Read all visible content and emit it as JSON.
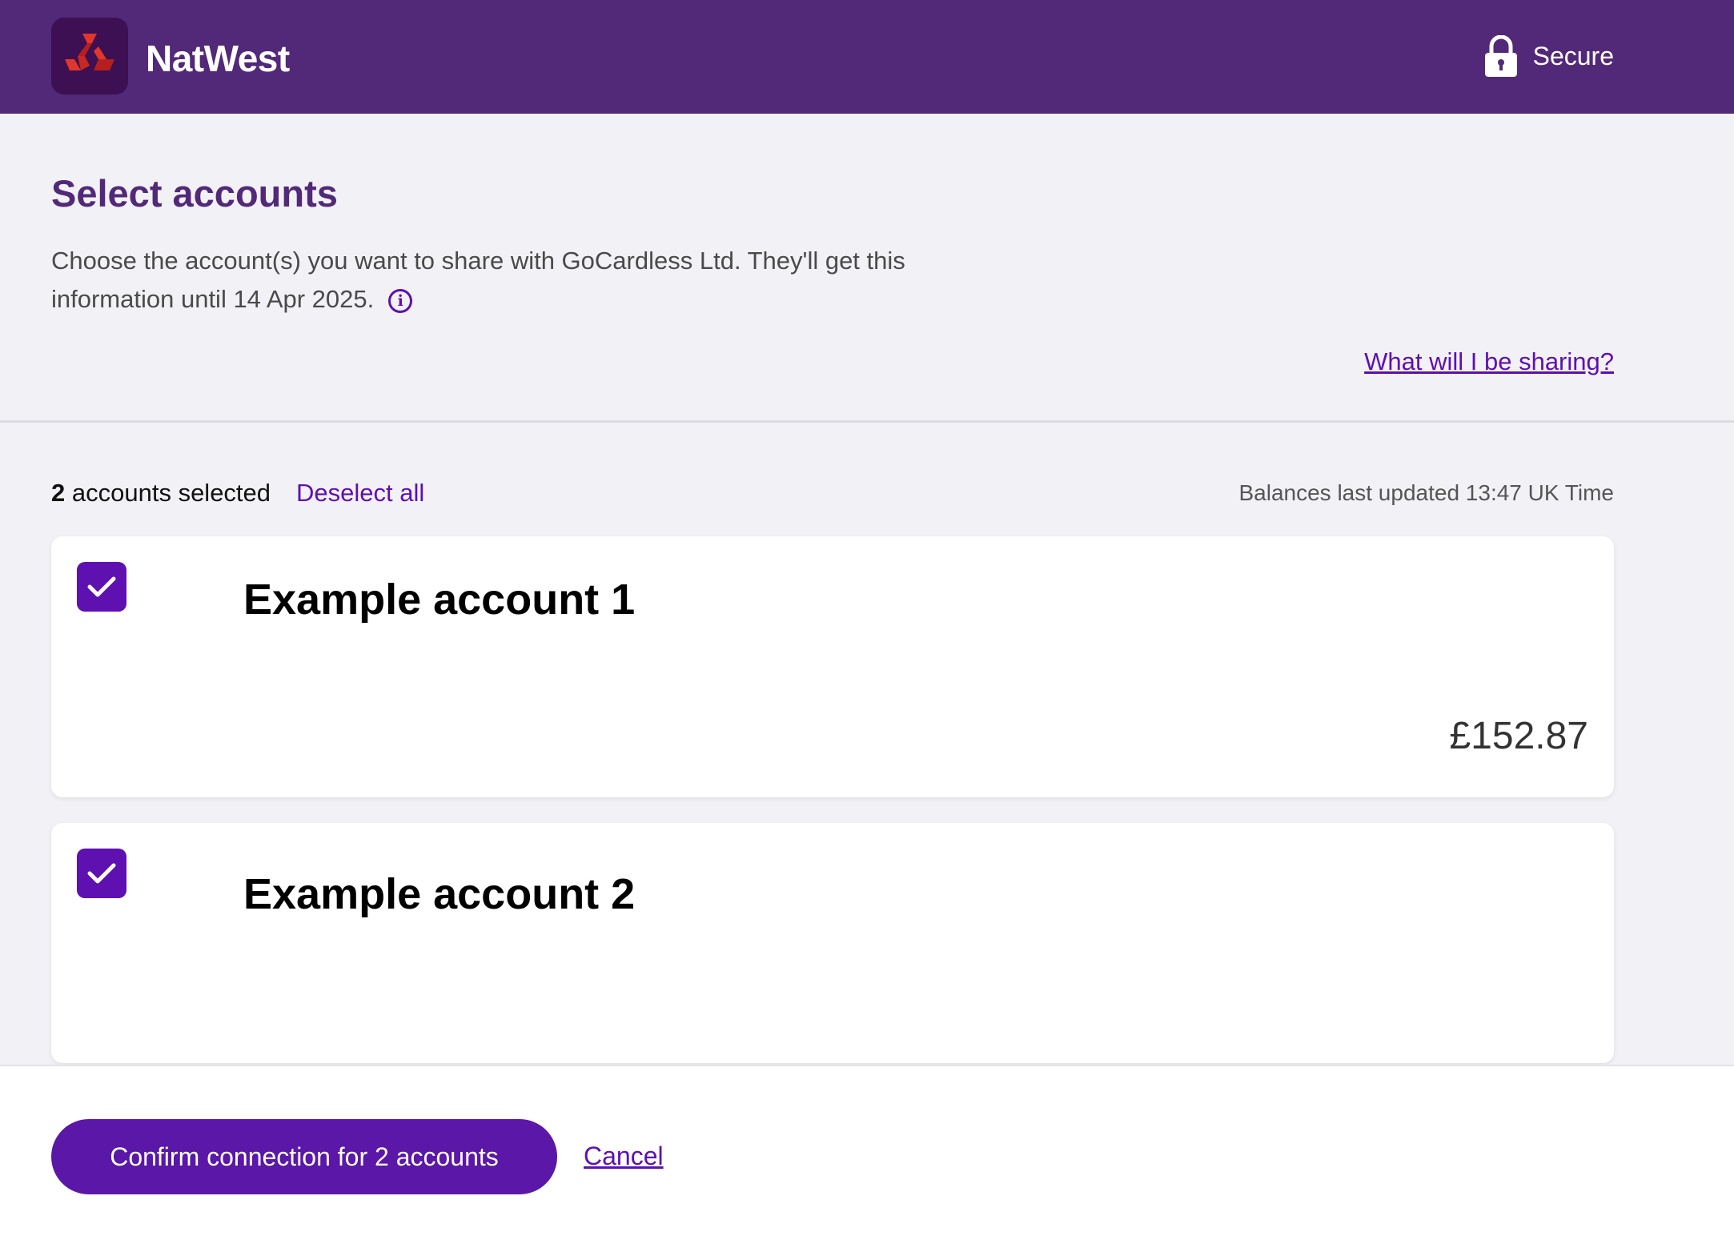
{
  "header": {
    "brand": "NatWest",
    "secure_label": "Secure",
    "colors": {
      "header_bg": "#522978",
      "accent": "#5e10b1",
      "logo_red": "#e0362b"
    }
  },
  "intro": {
    "title": "Select accounts",
    "description": "Choose the account(s) you want to share with GoCardless Ltd. They'll get this information until 14 Apr 2025.",
    "info_icon": "info-icon",
    "sharing_link": "What will I be sharing?"
  },
  "selection": {
    "count": "2",
    "count_suffix": "accounts selected",
    "deselect_label": "Deselect all",
    "balances_updated": "Balances last updated 13:47 UK Time"
  },
  "accounts": [
    {
      "name": "Example account 1",
      "balance": "£152.87",
      "checked": true
    },
    {
      "name": "Example account 2",
      "balance": "",
      "checked": true
    }
  ],
  "footer": {
    "confirm_label": "Confirm connection for 2 accounts",
    "cancel_label": "Cancel"
  }
}
